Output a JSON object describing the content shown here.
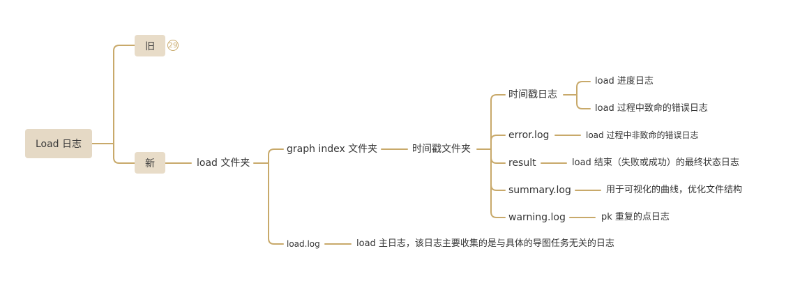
{
  "colors": {
    "branch": "#c8a96a",
    "box_fill": "#e8dcc8",
    "root_fill": "#e5d9c5",
    "text": "#333333"
  },
  "root": {
    "label": "Load 日志"
  },
  "old_node": {
    "label": "旧",
    "badge": "29"
  },
  "new_node": {
    "label": "新"
  },
  "load_folder": {
    "label": "load 文件夹"
  },
  "graph_index": {
    "label": "graph index 文件夹"
  },
  "timestamp_folder": {
    "label": "时间戳文件夹"
  },
  "timestamp_log": {
    "label": "时间戳日志"
  },
  "progress_log": {
    "label": "load 进度日志"
  },
  "fatal_log": {
    "label": "load 过程中致命的错误日志"
  },
  "error_log": {
    "label": "error.log"
  },
  "error_desc": {
    "label": "load 过程中非致命的错误日志"
  },
  "result": {
    "label": "result"
  },
  "result_desc": {
    "label": "load 结束（失败或成功）的最终状态日志"
  },
  "summary_log": {
    "label": "summary.log"
  },
  "summary_desc": {
    "label": "用于可视化的曲线，优化文件结构"
  },
  "warning_log": {
    "label": "warning.log"
  },
  "warning_desc": {
    "label": "pk 重复的点日志"
  },
  "load_log": {
    "label": "load.log"
  },
  "load_log_desc": {
    "label": "load 主日志，该日志主要收集的是与具体的导图任务无关的日志"
  }
}
